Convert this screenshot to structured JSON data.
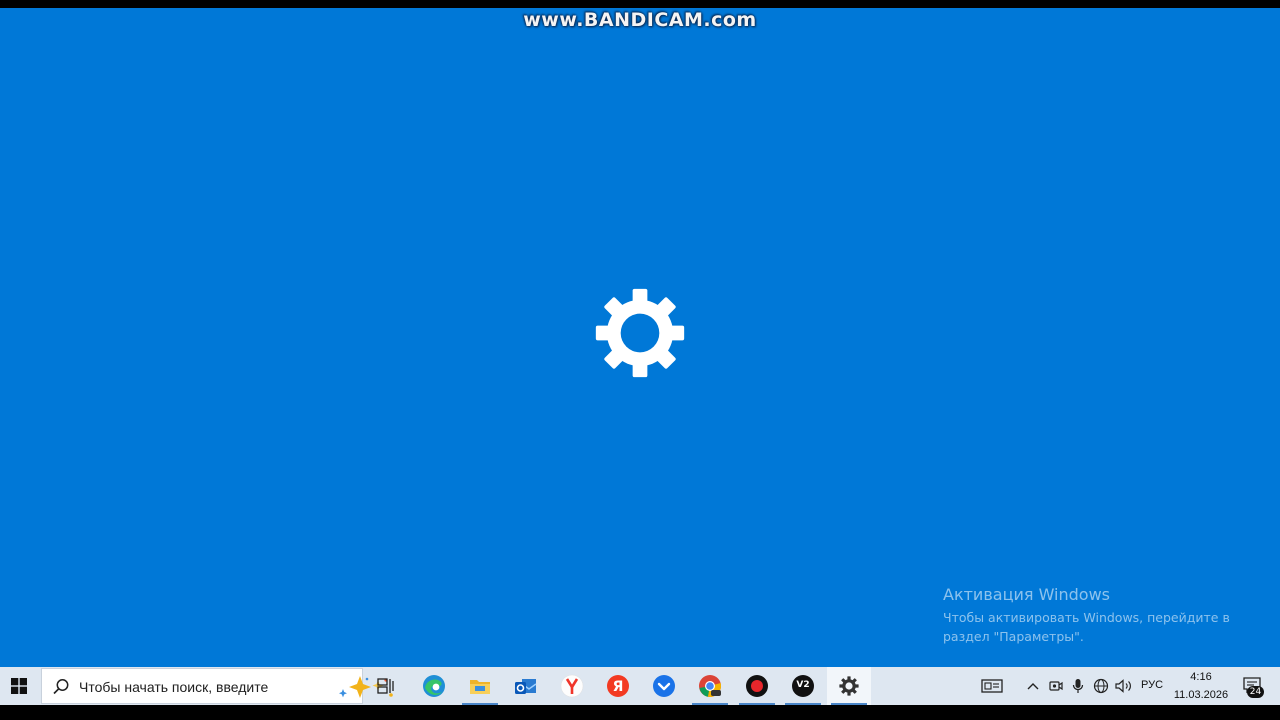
{
  "watermark": {
    "text": "www.BANDICAM.com"
  },
  "splash": {
    "icon": "gear-icon",
    "background": "#0078d7"
  },
  "activation": {
    "title": "Активация Windows",
    "line1": "Чтобы активировать Windows, перейдите в",
    "line2": "раздел \"Параметры\"."
  },
  "taskbar": {
    "search_placeholder": "Чтобы начать поиск, введите",
    "pinned": [
      {
        "name": "task-view",
        "icon": "task-view-icon"
      },
      {
        "name": "edge",
        "icon": "edge-icon"
      },
      {
        "name": "file-explorer",
        "icon": "folder-icon"
      },
      {
        "name": "outlook",
        "icon": "outlook-icon"
      },
      {
        "name": "yandex",
        "icon": "yandex-icon"
      },
      {
        "name": "yandex-browser",
        "icon": "yandex-browser-icon"
      },
      {
        "name": "download-app",
        "icon": "download-icon"
      },
      {
        "name": "chrome",
        "icon": "chrome-icon"
      },
      {
        "name": "bandicam",
        "icon": "record-icon"
      },
      {
        "name": "v2",
        "icon": "v2-icon",
        "label": "V2"
      },
      {
        "name": "settings",
        "icon": "gear-icon"
      }
    ],
    "tray": {
      "language": "РУС",
      "time": "4:16",
      "date": "11.03.2026",
      "notifications_count": "24"
    }
  }
}
